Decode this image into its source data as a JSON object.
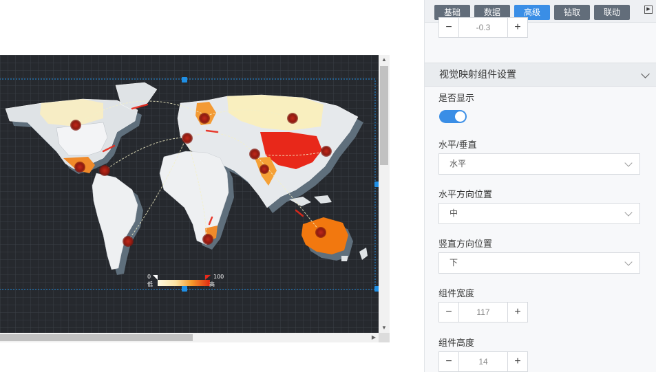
{
  "tabs": [
    {
      "label": "基础",
      "active": false
    },
    {
      "label": "数据",
      "active": false
    },
    {
      "label": "高级",
      "active": true
    },
    {
      "label": "钻取",
      "active": false
    },
    {
      "label": "联动",
      "active": false
    }
  ],
  "top_stepper": {
    "value": "-0.3"
  },
  "section": {
    "title": "视觉映射组件设置"
  },
  "fields": {
    "show": {
      "label": "是否显示",
      "enabled": true
    },
    "orientation": {
      "label": "水平/垂直",
      "value": "水平"
    },
    "h_position": {
      "label": "水平方向位置",
      "value": "中"
    },
    "v_position": {
      "label": "竖直方向位置",
      "value": "下"
    },
    "width": {
      "label": "组件宽度",
      "value": "117"
    },
    "height": {
      "label": "组件高度",
      "value": "14"
    }
  },
  "visual_map": {
    "min": "0",
    "max": "100",
    "low_label": "低",
    "high_label": "高"
  },
  "colors": {
    "accent": "#3a8ee6",
    "tab_bg": "#626d7a",
    "map_bg": "#26292e",
    "selection": "#1f8fe5"
  }
}
